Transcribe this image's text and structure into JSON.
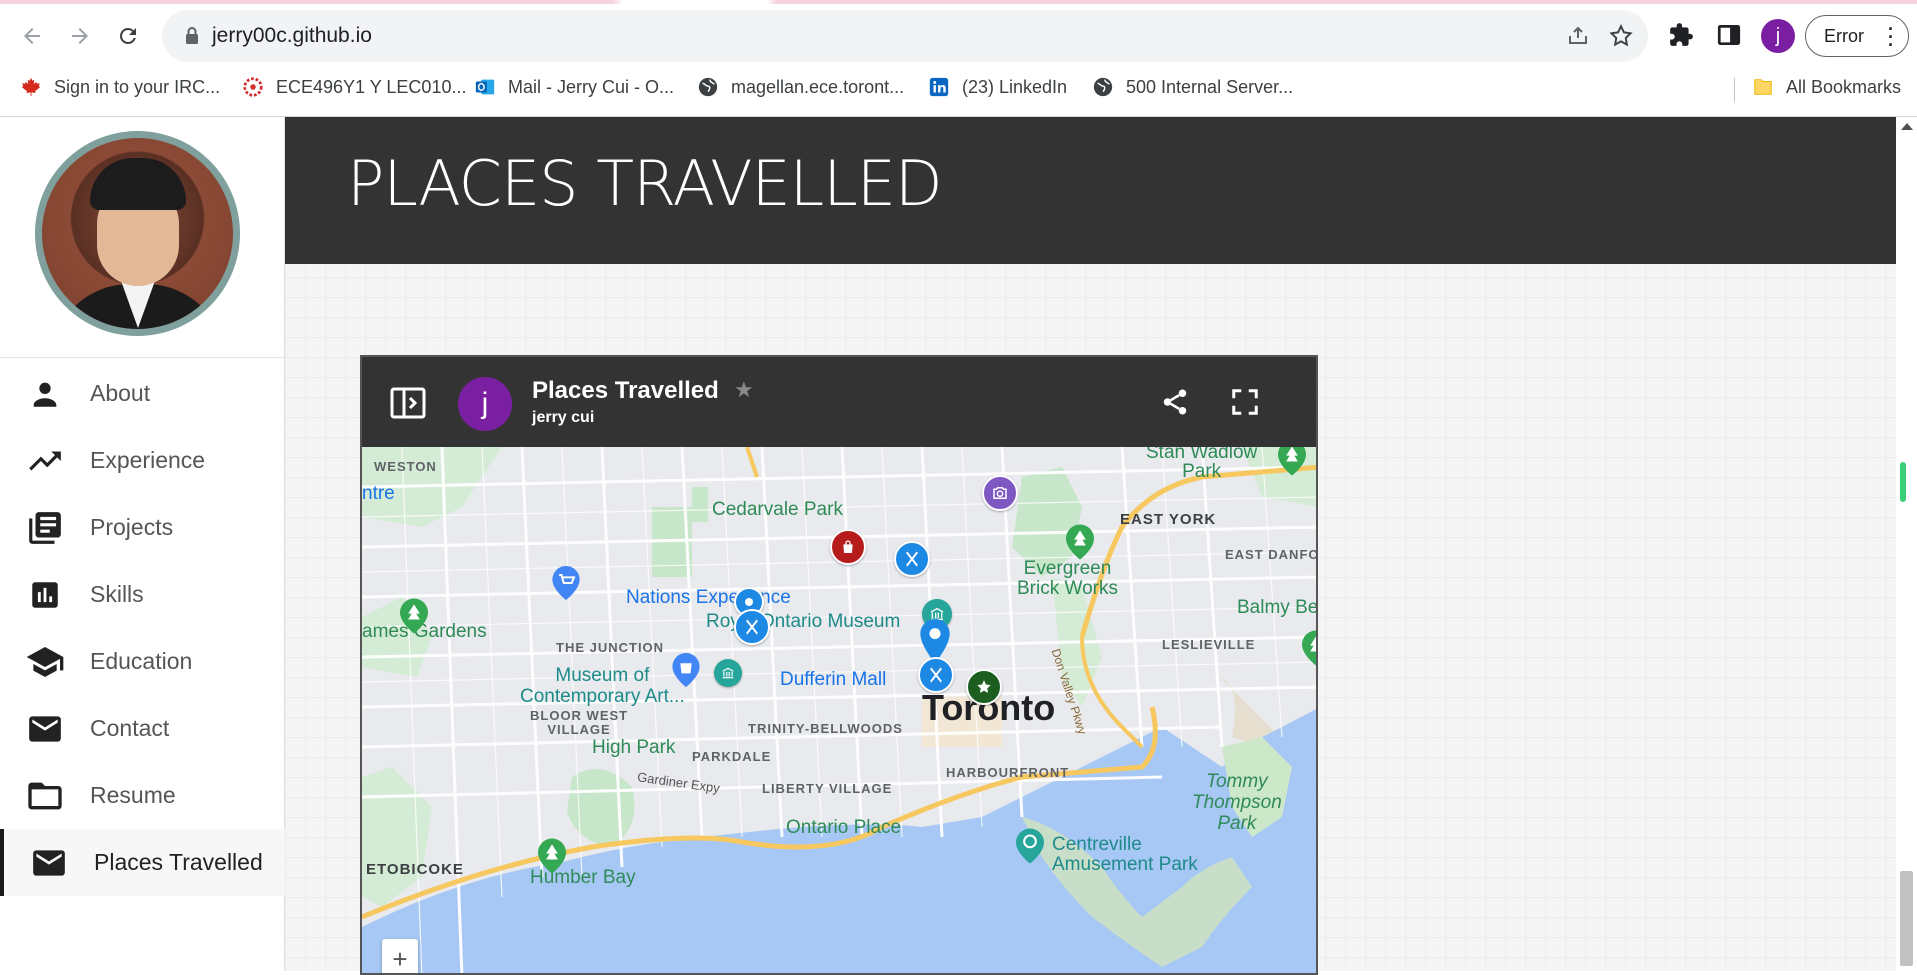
{
  "browser": {
    "url": "jerry00c.github.io",
    "profile_initial": "j",
    "error_label": "Error",
    "bookmarks": [
      {
        "label": "Sign in to your IRC...",
        "icon": "maple-leaf-icon"
      },
      {
        "label": "ECE496Y1 Y LEC010...",
        "icon": "uoft-icon"
      },
      {
        "label": "Mail - Jerry Cui - O...",
        "icon": "outlook-icon"
      },
      {
        "label": "magellan.ece.toront...",
        "icon": "globe-icon"
      },
      {
        "label": "(23) LinkedIn",
        "icon": "linkedin-icon"
      },
      {
        "label": "500 Internal Server...",
        "icon": "globe-icon"
      }
    ],
    "all_bookmarks": "All Bookmarks"
  },
  "sidebar": {
    "items": [
      {
        "label": "About",
        "icon": "person-icon"
      },
      {
        "label": "Experience",
        "icon": "trending-up-icon"
      },
      {
        "label": "Projects",
        "icon": "library-books-icon"
      },
      {
        "label": "Skills",
        "icon": "bar-chart-icon"
      },
      {
        "label": "Education",
        "icon": "school-icon"
      },
      {
        "label": "Contact",
        "icon": "mail-icon"
      },
      {
        "label": "Resume",
        "icon": "folder-icon"
      },
      {
        "label": "Places Travelled",
        "icon": "mail-icon"
      }
    ],
    "active_index": 7
  },
  "page": {
    "heading": "PLACES TRAVELLED"
  },
  "map": {
    "title": "Places Travelled",
    "owner": "jerry cui",
    "avatar_initial": "j",
    "zoom_in": "+",
    "labels": {
      "weston": "WESTON",
      "ntre": "ntre",
      "stan_wadlow": "Stan Wadlow\nPark",
      "cedarvale": "Cedarvale Park",
      "east_york": "EAST YORK",
      "east_danfo": "EAST DANFO",
      "evergreen": "Evergreen\nBrick Works",
      "nations": "Nations Experience",
      "rom": "Royal Ontario Museum",
      "balmy": "Balmy Be",
      "james_gardens": "ames Gardens",
      "junction": "THE JUNCTION",
      "leslieville": "LESLIEVILLE",
      "moca": "Museum of\nContemporary Art...",
      "dufferin": "Dufferin Mall",
      "toronto": "Toronto",
      "bloor_west": "BLOOR WEST\nVILLAGE",
      "trinity": "TRINITY-BELLWOODS",
      "high_park": "High Park",
      "parkdale": "PARKDALE",
      "gardiner": "Gardiner Expy",
      "liberty": "LIBERTY VILLAGE",
      "harbourfront": "HARBOURFRONT",
      "tommy": "Tommy\nThompson\nPark",
      "ontario_place": "Ontario Place",
      "centreville": "Centreville\nAmusement Park",
      "etobicoke": "ETOBICOKE",
      "humber_bay": "Humber Bay",
      "dvp": "Don Valley Pkwy"
    }
  }
}
